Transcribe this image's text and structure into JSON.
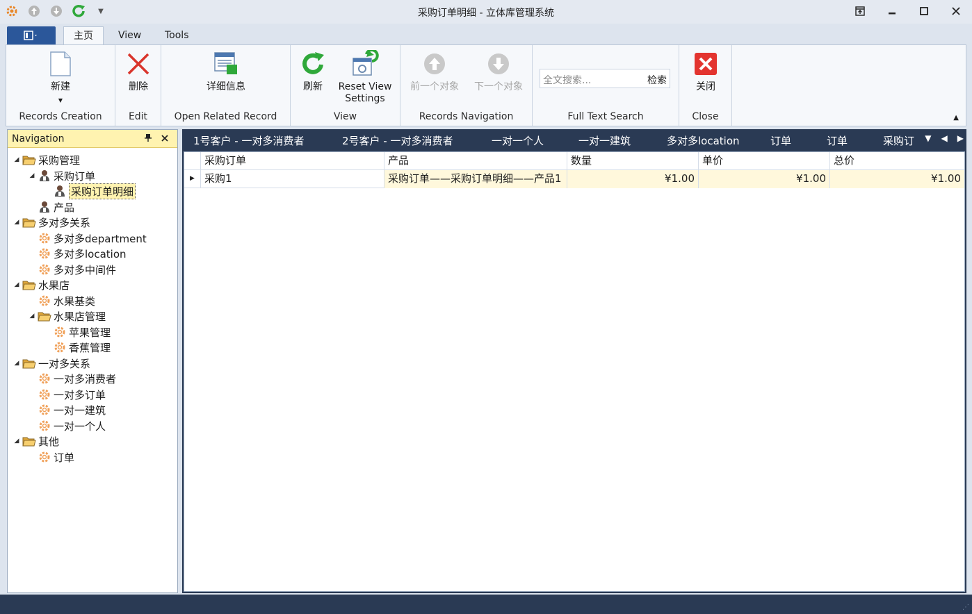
{
  "window": {
    "title": "采购订单明细 - 立体库管理系统",
    "quick_access": [
      "app-gear-icon",
      "back-icon",
      "forward-icon",
      "refresh-icon",
      "customize-dropdown-icon"
    ]
  },
  "ribbon": {
    "tabs": [
      {
        "label": "主页",
        "active": true
      },
      {
        "label": "View",
        "active": false
      },
      {
        "label": "Tools",
        "active": false
      }
    ],
    "groups": {
      "records_creation": {
        "label": "Records Creation",
        "new_label": "新建"
      },
      "edit": {
        "label": "Edit",
        "delete_label": "删除"
      },
      "open_related": {
        "label": "Open Related Record",
        "details_label": "详细信息"
      },
      "view": {
        "label": "View",
        "refresh_label": "刷新",
        "reset_label_1": "Reset View",
        "reset_label_2": "Settings"
      },
      "navigation": {
        "label": "Records Navigation",
        "prev_label": "前一个对象",
        "next_label": "下一个对象"
      },
      "search": {
        "label": "Full Text Search",
        "placeholder": "全文搜索...",
        "button_label": "检索"
      },
      "close": {
        "label": "Close",
        "close_label": "关闭"
      }
    }
  },
  "navigation": {
    "title": "Navigation",
    "tree": {
      "n0": "采购管理",
      "n1": "采购订单",
      "n2": "采购订单明细",
      "n3": "产品",
      "n4": "多对多关系",
      "n5": "多对多department",
      "n6": "多对多location",
      "n7": "多对多中间件",
      "n8": "水果店",
      "n9": "水果基类",
      "n10": "水果店管理",
      "n11": "苹果管理",
      "n12": "香蕉管理",
      "n13": "一对多关系",
      "n14": "一对多消费者",
      "n15": "一对多订单",
      "n16": "一对一建筑",
      "n17": "一对一个人",
      "n18": "其他",
      "n19": "订单"
    }
  },
  "doc_tabs": [
    "1号客户 - 一对多消费者",
    "2号客户 - 一对多消费者",
    "一对一个人",
    "一对一建筑",
    "多对多location",
    "订单",
    "订单",
    "采购订"
  ],
  "grid": {
    "columns": [
      "采购订单",
      "产品",
      "数量",
      "单价",
      "总价"
    ],
    "rows": [
      {
        "order": "采购1",
        "product": "采购订单——采购订单明细——产品1",
        "qty": "¥1.00",
        "price": "¥1.00",
        "total": "¥1.00"
      }
    ]
  },
  "colors": {
    "accent": "#2b579a",
    "dark_frame": "#2a3a54",
    "nav_header": "#fff3b0",
    "close_red": "#e3342f"
  }
}
